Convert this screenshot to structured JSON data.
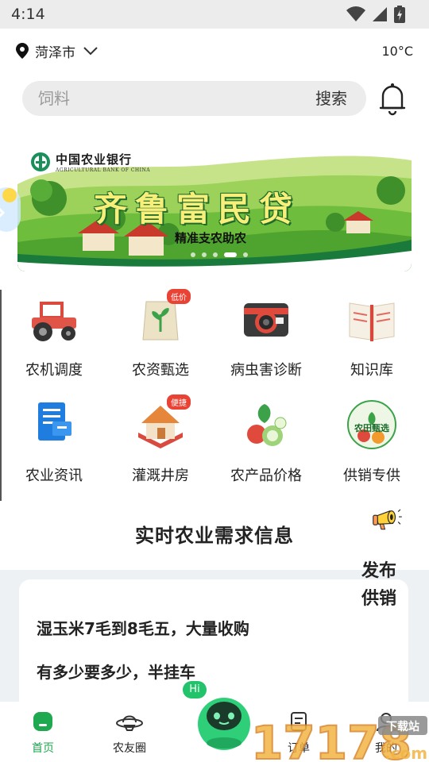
{
  "status_bar": {
    "time": "4:14"
  },
  "location": {
    "city": "菏泽市",
    "temperature": "10°C"
  },
  "search": {
    "placeholder": "饲料",
    "button_label": "搜索"
  },
  "banner": {
    "bank_name": "中国农业银行",
    "bank_name_en": "AGRICULTURAL BANK OF CHINA",
    "title": "齐鲁富民贷",
    "subtitle": "精准支农助农",
    "page_count": 5,
    "active_page": 4
  },
  "grid": {
    "items": [
      {
        "label": "农机调度",
        "icon": "tractor-icon"
      },
      {
        "label": "农资甄选",
        "icon": "seed-bag-icon",
        "badge": "低价"
      },
      {
        "label": "病虫害诊断",
        "icon": "camera-icon"
      },
      {
        "label": "知识库",
        "icon": "book-icon"
      },
      {
        "label": "农业资讯",
        "icon": "news-icon"
      },
      {
        "label": "灌溉井房",
        "icon": "house-icon",
        "badge": "便捷"
      },
      {
        "label": "农产品价格",
        "icon": "vegetables-icon"
      },
      {
        "label": "供销专供",
        "icon": "farm-select-icon",
        "icon_text": "农田甄选"
      }
    ]
  },
  "demand": {
    "title": "实时农业需求信息",
    "publish_label_1": "发布",
    "publish_label_2": "供销",
    "card_lines": [
      "湿玉米7毛到8毛五，大量收购",
      "有多少要多少，半挂车"
    ]
  },
  "bottom_nav": {
    "items": [
      {
        "label": "首页",
        "active": true
      },
      {
        "label": "农友圈",
        "active": false
      },
      {
        "label": "订单",
        "active": false
      },
      {
        "label": "我的",
        "active": false
      }
    ],
    "mascot_bubble": "Hi"
  },
  "watermark": {
    "text": "17178",
    "suffix": ".com",
    "badge": "下载站"
  },
  "colors": {
    "accent_green": "#1ea84f",
    "badge_red": "#e94335"
  }
}
